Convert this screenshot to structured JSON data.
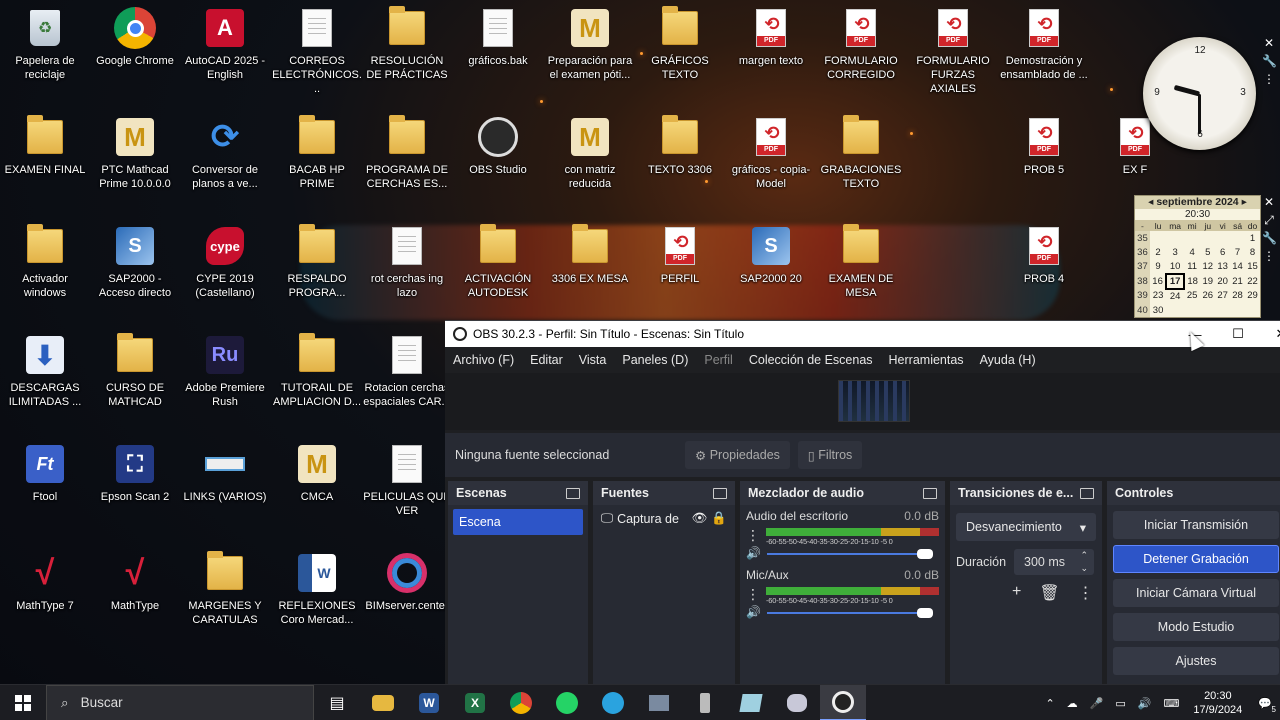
{
  "desktop_icons": [
    {
      "label": "Papelera de reciclaje",
      "icon": "recycle-bin-icon"
    },
    {
      "label": "Google Chrome",
      "icon": "chrome-icon"
    },
    {
      "label": "AutoCAD 2025 - English",
      "icon": "autocad-icon"
    },
    {
      "label": "CORREOS ELECTRÓNICOS...",
      "icon": "document-icon"
    },
    {
      "label": "RESOLUCIÓN DE PRÁCTICAS",
      "icon": "folder-icon"
    },
    {
      "label": "gráficos.bak",
      "icon": "document-icon"
    },
    {
      "label": "Preparación para el examen póti...",
      "icon": "mathcad-icon"
    },
    {
      "label": "GRÁFICOS TEXTO",
      "icon": "folder-icon"
    },
    {
      "label": "margen texto",
      "icon": "pdf-icon"
    },
    {
      "label": "FORMULARIO CORREGIDO",
      "icon": "pdf-icon"
    },
    {
      "label": "FORMULARIO FURZAS AXIALES",
      "icon": "pdf-icon"
    },
    {
      "label": "Demostración y ensamblado de ...",
      "icon": "pdf-icon"
    },
    {
      "label": "EXAMEN FINAL",
      "icon": "folder-icon"
    },
    {
      "label": "PTC Mathcad Prime 10.0.0.0",
      "icon": "mathcad-icon"
    },
    {
      "label": "Conversor de planos a ve...",
      "icon": "converter-icon"
    },
    {
      "label": "BACAB HP PRIME",
      "icon": "folder-icon"
    },
    {
      "label": "PROGRAMA DE CERCHAS ES...",
      "icon": "folder-icon"
    },
    {
      "label": "OBS Studio",
      "icon": "obs-icon"
    },
    {
      "label": "con matriz reducida",
      "icon": "mathcad-icon"
    },
    {
      "label": "TEXTO 3306",
      "icon": "folder-icon"
    },
    {
      "label": "gráficos - copia-Model",
      "icon": "pdf-icon"
    },
    {
      "label": "GRABACIONES TEXTO",
      "icon": "folder-icon"
    },
    {
      "label": "PROB 5",
      "icon": "pdf-icon"
    },
    {
      "label": "EX F",
      "icon": "pdf-icon"
    },
    {
      "label": "Activador windows",
      "icon": "folder-icon"
    },
    {
      "label": "SAP2000 - Acceso directo",
      "icon": "sap-icon"
    },
    {
      "label": "CYPE 2019 (Castellano)",
      "icon": "cype-icon"
    },
    {
      "label": "RESPALDO PROGRA...",
      "icon": "folder-icon"
    },
    {
      "label": "rot cerchas ing lazo",
      "icon": "document-icon"
    },
    {
      "label": "ACTIVACIÓN AUTODESK",
      "icon": "folder-icon"
    },
    {
      "label": "3306 EX MESA",
      "icon": "folder-icon"
    },
    {
      "label": "PERFIL",
      "icon": "pdf-icon"
    },
    {
      "label": "SAP2000 20",
      "icon": "sap-icon"
    },
    {
      "label": "EXAMEN DE MESA",
      "icon": "folder-icon"
    },
    {
      "label": "PROB 4",
      "icon": "pdf-icon"
    },
    {
      "label": "DESCARGAS ILIMITADAS ...",
      "icon": "download-icon"
    },
    {
      "label": "CURSO DE MATHCAD",
      "icon": "folder-icon"
    },
    {
      "label": "Adobe Premiere Rush",
      "icon": "premiere-rush-icon"
    },
    {
      "label": "TUTORAIL DE AMPLIACION D...",
      "icon": "folder-icon"
    },
    {
      "label": "Rotacion cerchas espaciales CAR...",
      "icon": "document-icon"
    },
    {
      "label": "Ftool",
      "icon": "ftool-icon"
    },
    {
      "label": "Epson Scan 2",
      "icon": "scanner-icon"
    },
    {
      "label": "LINKS (VARIOS)",
      "icon": "links-icon"
    },
    {
      "label": "CMCA",
      "icon": "mathcad-icon"
    },
    {
      "label": "PELICULAS QUE VER",
      "icon": "document-icon"
    },
    {
      "label": "MathType 7",
      "icon": "mathtype-icon"
    },
    {
      "label": "MathType",
      "icon": "mathtype-icon"
    },
    {
      "label": "MARGENES Y CARATULAS",
      "icon": "folder-icon"
    },
    {
      "label": "REFLEXIONES Coro Mercad...",
      "icon": "word-icon"
    },
    {
      "label": "BIMserver.center",
      "icon": "bimserver-icon"
    }
  ],
  "clock": {
    "hour": 9,
    "minute": 30
  },
  "calendar": {
    "title": "septiembre 2024",
    "time": "20:30",
    "weekdays": [
      "lu",
      "ma",
      "mi",
      "ju",
      "vi",
      "sá",
      "do"
    ],
    "weeks": [
      {
        "wk": "35",
        "days": [
          "",
          "",
          "",
          "",
          "",
          "",
          "1"
        ]
      },
      {
        "wk": "36",
        "days": [
          "2",
          "3",
          "4",
          "5",
          "6",
          "7",
          "8"
        ]
      },
      {
        "wk": "37",
        "days": [
          "9",
          "10",
          "11",
          "12",
          "13",
          "14",
          "15"
        ]
      },
      {
        "wk": "38",
        "days": [
          "16",
          "17",
          "18",
          "19",
          "20",
          "21",
          "22"
        ]
      },
      {
        "wk": "39",
        "days": [
          "23",
          "24",
          "25",
          "26",
          "27",
          "28",
          "29"
        ]
      },
      {
        "wk": "40",
        "days": [
          "30",
          "",
          "",
          "",
          "",
          "",
          ""
        ]
      }
    ],
    "today": "17"
  },
  "obs": {
    "title": "OBS 30.2.3 - Perfil: Sin Título - Escenas: Sin Título",
    "menu": [
      "Archivo (F)",
      "Editar",
      "Vista",
      "Paneles (D)",
      "Perfil",
      "Colección de Escenas",
      "Herramientas",
      "Ayuda (H)"
    ],
    "no_source": "Ninguna fuente seleccionad",
    "properties_btn": "Propiedades",
    "filters_btn": "Filtros",
    "docks": {
      "scenes": "Escenas",
      "sources": "Fuentes",
      "mixer": "Mezclador de audio",
      "transitions": "Transiciones de e...",
      "controls": "Controles"
    },
    "scene_item": "Escena",
    "source_item": "Captura de",
    "mixer_channels": [
      {
        "name": "Audio del escritorio",
        "db": "0.0 dB"
      },
      {
        "name": "Mic/Aux",
        "db": "0.0 dB"
      }
    ],
    "meter_ticks": "-60-55-50-45-40-35-30-25-20-15-10 -5  0",
    "transition_select": "Desvanecimiento",
    "duration_label": "Duración",
    "duration_value": "300 ms",
    "controls": [
      "Iniciar Transmisión",
      "Detener Grabación",
      "Iniciar Cámara Virtual",
      "Modo Estudio",
      "Ajustes"
    ]
  },
  "taskbar": {
    "search_placeholder": "Buscar",
    "time": "20:30",
    "date": "17/9/2024",
    "notifications": "5"
  }
}
